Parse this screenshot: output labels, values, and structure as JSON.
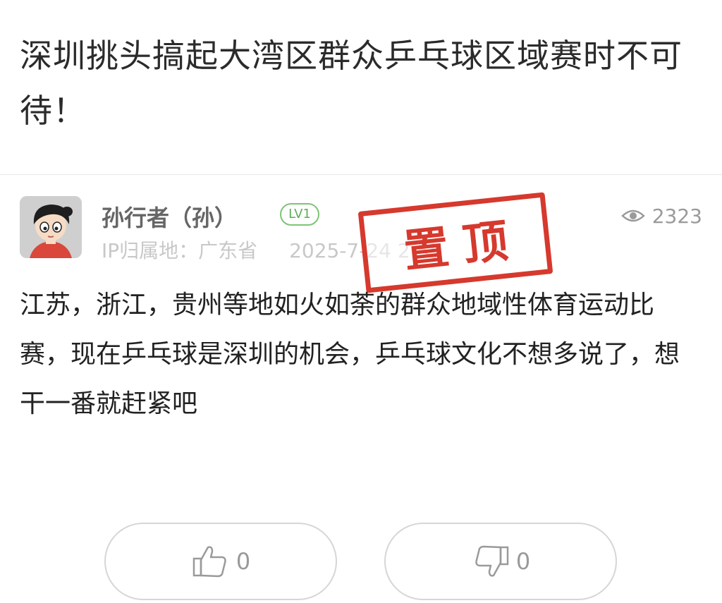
{
  "post": {
    "title": "深圳挑头搞起大湾区群众乒乓球区域赛时不可待！",
    "author": "孙行者（孙）",
    "level": "LV1",
    "ip_location": "IP归属地：广东省",
    "date": "2025-7-24 2:55",
    "views": "2323",
    "pinned_label": "置顶",
    "body": "江苏，浙江，贵州等地如火如荼的群众地域性体育运动比赛，现在乒乓球是深圳的机会，乒乓球文化不想多说了，想干一番就赶紧吧"
  },
  "actions": {
    "like_count": "0",
    "dislike_count": "0"
  },
  "icons": {
    "views": "eye-icon",
    "like": "thumbs-up-icon",
    "dislike": "thumbs-down-icon"
  },
  "colors": {
    "level_badge": "#5cae55",
    "stamp": "#d6392d"
  }
}
